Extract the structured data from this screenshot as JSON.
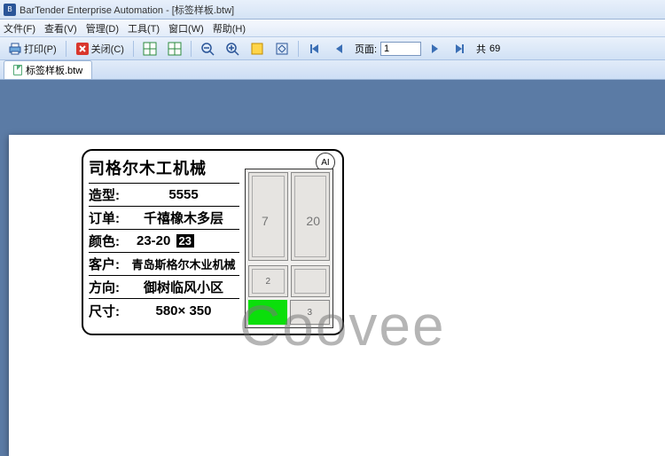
{
  "title": "BarTender Enterprise Automation - [标签样板.btw]",
  "menu": {
    "file": "文件(F)",
    "view": "查看(V)",
    "manage": "管理(D)",
    "tools": "工具(T)",
    "window": "窗口(W)",
    "help": "帮助(H)"
  },
  "toolbar": {
    "print": "打印(P)",
    "close": "关闭(C)",
    "page_label": "页面:",
    "page_value": "1",
    "total_prefix": "共",
    "total": "69"
  },
  "tab": {
    "name": "标签样板.btw"
  },
  "label": {
    "title": "司格尔木工机械",
    "rows": {
      "style_k": "造型:",
      "style_v": "5555",
      "order_k": "订单:",
      "order_v": "千禧橡木多层",
      "color_k": "颜色:",
      "color_v": "23-20",
      "color_chip": "23",
      "cust_k": "客户:",
      "cust_v": "青岛斯格尔木业机械",
      "dir_k": "方向:",
      "dir_v": "御树临风小区",
      "size_k": "尺寸:",
      "size_v": "580× 350"
    },
    "overlay": {
      "n7": "7",
      "n20": "20",
      "n2": "2",
      "n3": "3",
      "ai": "AI"
    }
  },
  "watermark": "Coovee"
}
